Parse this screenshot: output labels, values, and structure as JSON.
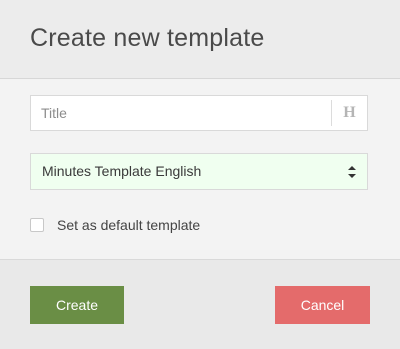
{
  "dialog": {
    "title": "Create new template",
    "title_field": {
      "placeholder": "Title",
      "value": "",
      "heading_toggle_label": "H"
    },
    "template_select": {
      "selected": "Minutes Template English",
      "background_color": "#f0fff0"
    },
    "default_checkbox": {
      "label": "Set as default template",
      "checked": false
    },
    "buttons": {
      "create_label": "Create",
      "cancel_label": "Cancel"
    }
  },
  "colors": {
    "create_button": "#6a8e45",
    "cancel_button": "#e46b6b",
    "header_background": "#ececec",
    "body_background": "#f3f3f3"
  },
  "icons": {
    "heading": "heading-icon",
    "select_arrows": "select-arrows-icon"
  }
}
